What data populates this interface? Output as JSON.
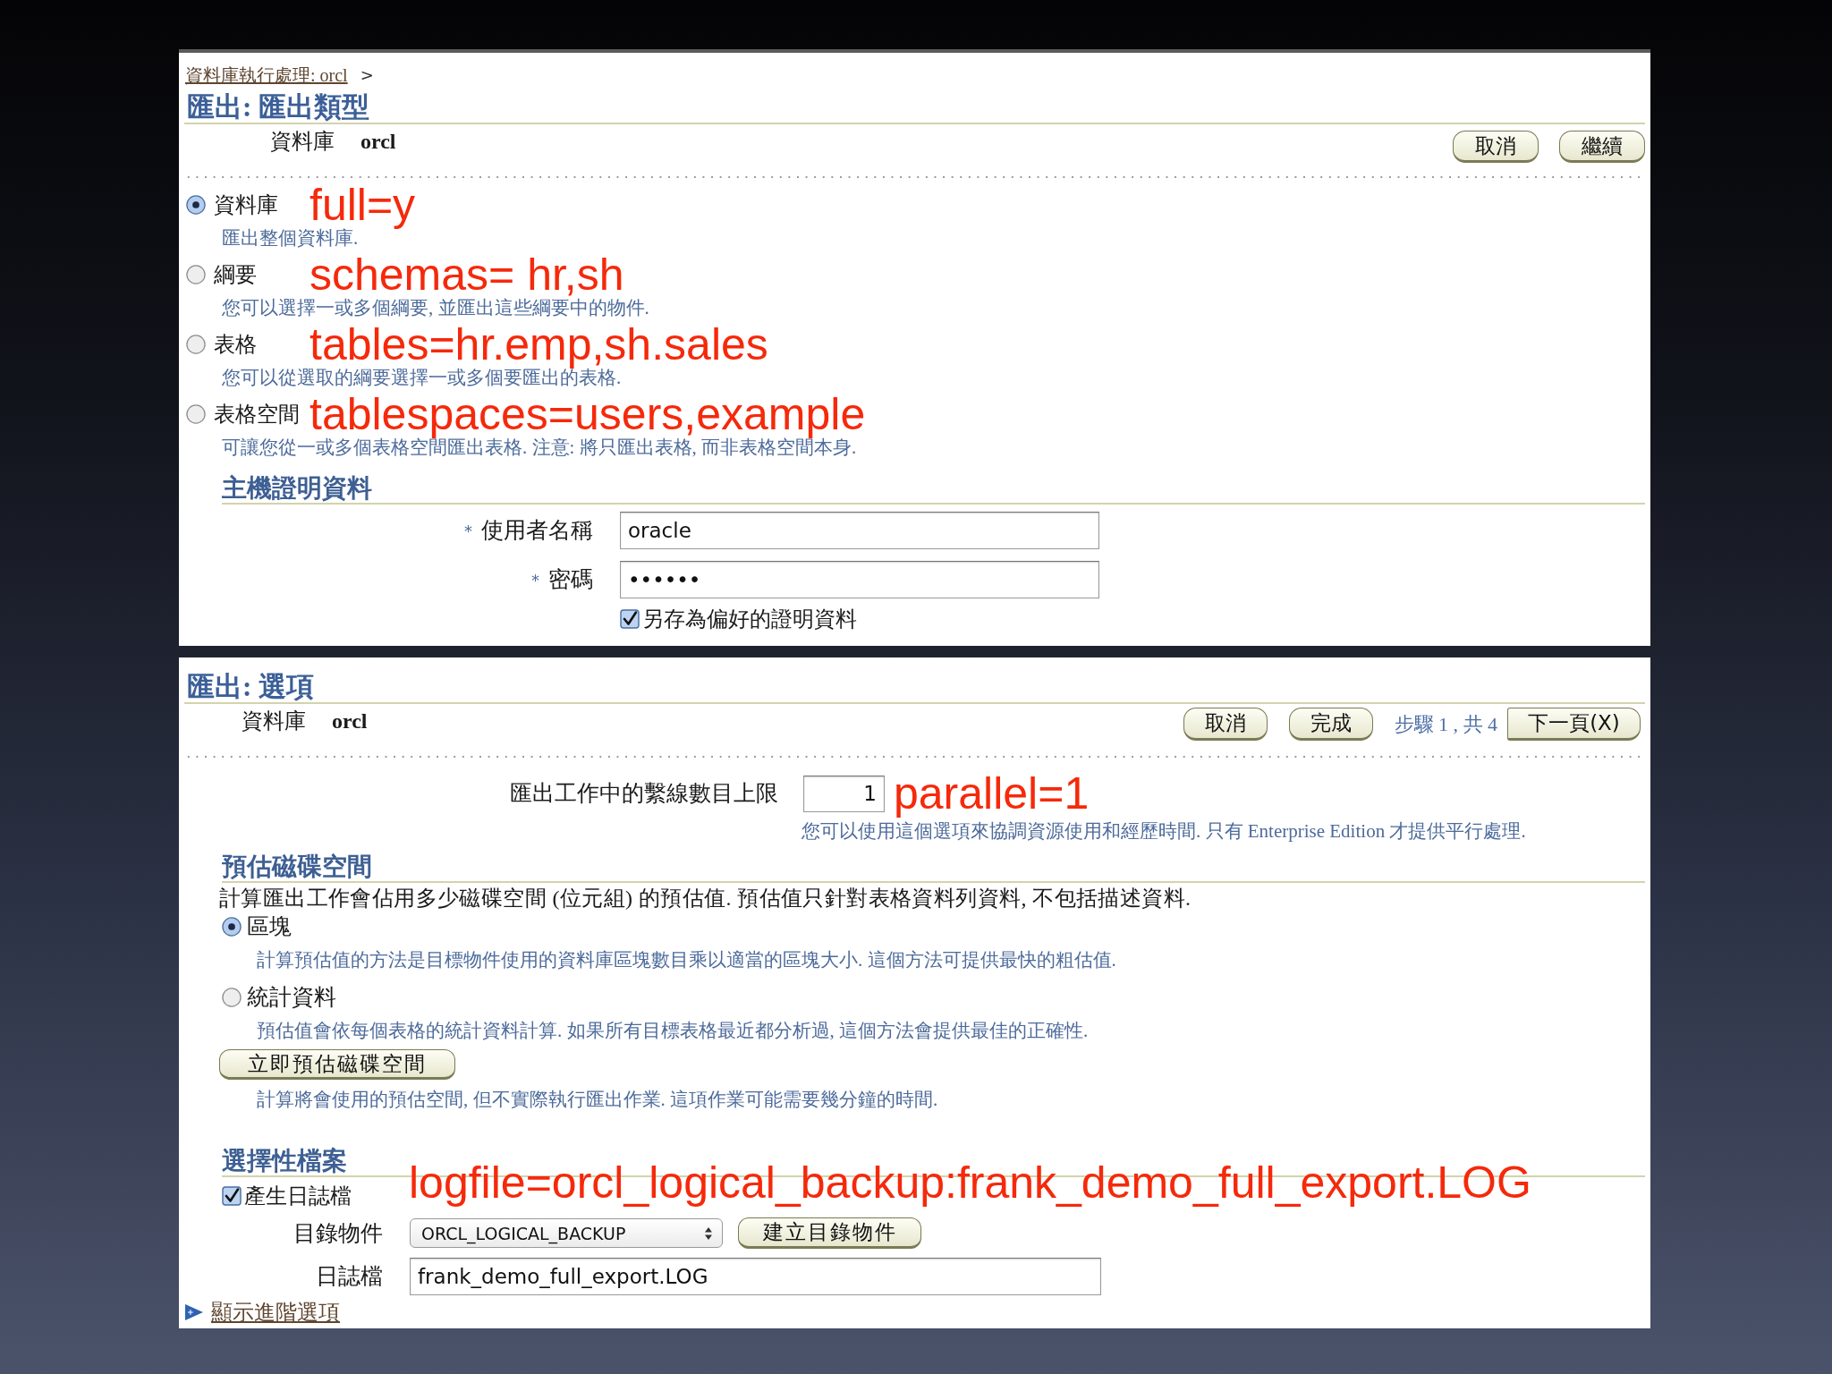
{
  "export_type_page": {
    "breadcrumb": {
      "link": "資料庫執行處理: orcl",
      "separator": ">"
    },
    "title": "匯出: 匯出類型",
    "database": {
      "label": "資料庫",
      "value": "orcl"
    },
    "buttons": [
      {
        "label": "取消"
      },
      {
        "label": "繼續"
      }
    ],
    "export_types": [
      {
        "label": "資料庫",
        "selected": true,
        "annotation": "full=y",
        "description": "匯出整個資料庫."
      },
      {
        "label": "綱要",
        "selected": false,
        "annotation": "schemas= hr,sh",
        "description": "您可以選擇一或多個綱要, 並匯出這些綱要中的物件."
      },
      {
        "label": "表格",
        "selected": false,
        "annotation": "tables=hr.emp,sh.sales",
        "description": "您可以從選取的綱要選擇一或多個要匯出的表格."
      },
      {
        "label": "表格空間",
        "selected": false,
        "annotation": "tablespaces=users,example",
        "description": "可讓您從一或多個表格空間匯出表格. 注意: 將只匯出表格, 而非表格空間本身."
      }
    ],
    "host_credentials": {
      "heading": "主機證明資料",
      "fields": [
        {
          "marker": "*",
          "label": "使用者名稱",
          "value": "oracle"
        },
        {
          "marker": "*",
          "label": "密碼",
          "value": "••••••"
        }
      ],
      "save_preferred": {
        "label": "另存為偏好的證明資料",
        "checked": true
      }
    }
  },
  "options_page": {
    "title": "匯出: 選項",
    "database": {
      "label": "資料庫",
      "value": "orcl"
    },
    "buttons": [
      {
        "label": "取消"
      },
      {
        "label": "完成"
      }
    ],
    "step": "步驟 1 , 共 4",
    "next_button": {
      "label": "下一頁(X)"
    },
    "parallel": {
      "label": "匯出工作中的繫線數目上限",
      "value": "1",
      "annotation": "parallel=1",
      "hint": "您可以使用這個選項來協調資源使用和經歷時間. 只有 Enterprise Edition 才提供平行處理."
    },
    "disk_space": {
      "heading": "預估磁碟空間",
      "description": "計算匯出工作會佔用多少磁碟空間 (位元組) 的預估值. 預估值只針對表格資料列資料, 不包括描述資料.",
      "methods": [
        {
          "label": "區塊",
          "selected": true,
          "description": "計算預估值的方法是目標物件使用的資料庫區塊數目乘以適當的區塊大小. 這個方法可提供最快的粗估值."
        },
        {
          "label": "統計資料",
          "selected": false,
          "description": "預估值會依每個表格的統計資料計算. 如果所有目標表格最近都分析過, 這個方法會提供最佳的正確性."
        }
      ],
      "estimate_button": "立即預估磁碟空間",
      "estimate_hint": "計算將會使用的預估空間, 但不實際執行匯出作業. 這項作業可能需要幾分鐘的時間."
    },
    "optional_files": {
      "heading": "選擇性檔案",
      "annotation": "logfile=orcl_logical_backup:frank_demo_full_export.LOG",
      "generate_log": {
        "label": "產生日誌檔",
        "checked": true
      },
      "directory_object": {
        "label": "目錄物件",
        "value": "ORCL_LOGICAL_BACKUP",
        "button": "建立目錄物件"
      },
      "log_file": {
        "label": "日誌檔",
        "value": "frank_demo_full_export.LOG"
      },
      "advanced_link": "顯示進階選項"
    }
  }
}
